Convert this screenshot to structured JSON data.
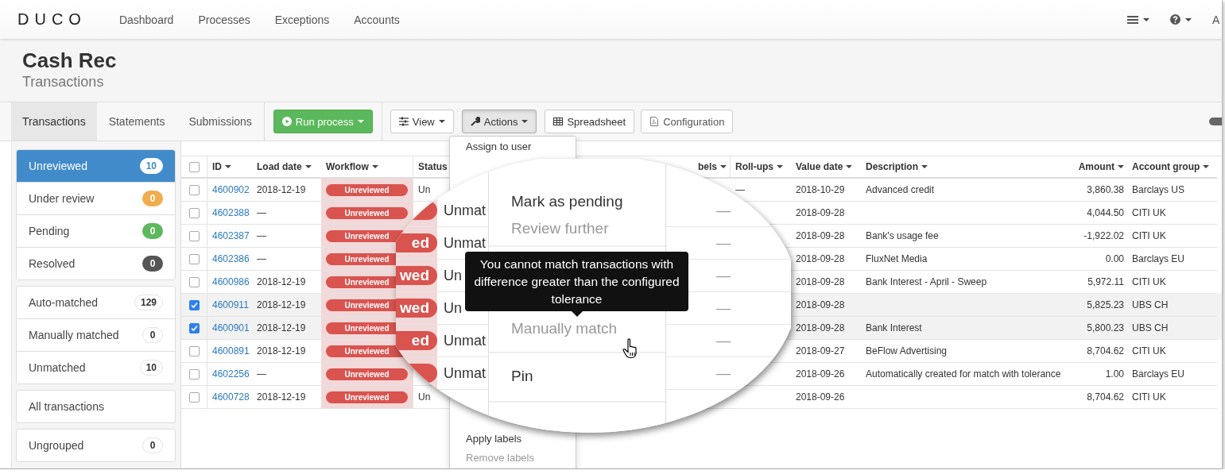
{
  "nav": {
    "logo": "DUCO",
    "links": [
      "Dashboard",
      "Processes",
      "Exceptions",
      "Accounts"
    ],
    "user_initial": "A"
  },
  "header": {
    "title": "Cash Rec",
    "subtitle": "Transactions"
  },
  "tabs": [
    {
      "label": "Transactions",
      "selected": true
    },
    {
      "label": "Statements",
      "selected": false
    },
    {
      "label": "Submissions",
      "selected": false
    }
  ],
  "toolbar": [
    {
      "label": "Run process",
      "kind": "run",
      "caret": true,
      "pressed": false
    },
    {
      "label": "View",
      "kind": "view",
      "caret": true,
      "pressed": false
    },
    {
      "label": "Actions",
      "kind": "actions",
      "caret": true,
      "pressed": true
    },
    {
      "label": "Spreadsheet",
      "kind": "spreadsheet",
      "caret": false,
      "pressed": false
    },
    {
      "label": "Configuration",
      "kind": "configuration",
      "caret": false,
      "pressed": false
    }
  ],
  "toolbar_toggle": {
    "on": true
  },
  "sidebar": {
    "groups": [
      {
        "items": [
          {
            "label": "Unreviewed",
            "count": "10",
            "color": "#ffffff",
            "selected": true
          },
          {
            "label": "Under review",
            "count": "0",
            "color": "#f0ad4e",
            "selected": false
          },
          {
            "label": "Pending",
            "count": "0",
            "color": "#5cb85c",
            "selected": false
          },
          {
            "label": "Resolved",
            "count": "0",
            "color": "#555555",
            "selected": false
          }
        ]
      },
      {
        "items": [
          {
            "label": "Auto-matched",
            "count": "129",
            "color": "#ffffff",
            "selected": false
          },
          {
            "label": "Manually matched",
            "count": "0",
            "color": "#ffffff",
            "selected": false
          },
          {
            "label": "Unmatched",
            "count": "10",
            "color": "#ffffff",
            "selected": false
          }
        ]
      },
      {
        "items": [
          {
            "label": "All transactions",
            "selected": false
          }
        ]
      },
      {
        "items": [
          {
            "label": "Ungrouped",
            "count": "0",
            "color": "#ffffff",
            "selected": false
          }
        ]
      }
    ]
  },
  "table": {
    "select_all_checked": false,
    "columns": [
      "ID",
      "Load date",
      "Workflow",
      "Status",
      "bels",
      "Roll-ups",
      "Value date",
      "Description",
      "Amount",
      "Account group"
    ],
    "rows": [
      {
        "checked": false,
        "id": "4600902",
        "load_date": "2018-12-19",
        "workflow": "Unreviewed",
        "status": "Un",
        "roll_ups": "—",
        "value_date": "2018-10-29",
        "description": "Advanced credit",
        "amount": "3,860.38",
        "account_group": "Barclays US"
      },
      {
        "checked": false,
        "id": "4602388",
        "load_date": "—",
        "workflow": "Unreviewed",
        "value_date": "2018-09-28",
        "amount": "4,044.50",
        "account_group": "CITI UK"
      },
      {
        "checked": false,
        "id": "4602387",
        "load_date": "—",
        "workflow": "Unreviewed",
        "value_date": "2018-09-28",
        "description": "Bank's usage fee",
        "amount": "-1,922.02",
        "account_group": "CITI UK"
      },
      {
        "checked": false,
        "id": "4602386",
        "load_date": "—",
        "workflow": "Unreviewed",
        "value_date": "2018-09-28",
        "description": "FluxNet Media",
        "amount": "0.00",
        "account_group": "Barclays EU"
      },
      {
        "checked": false,
        "id": "4600986",
        "load_date": "2018-12-19",
        "workflow": "Unreviewed",
        "value_date": "2018-09-28",
        "description": "Bank Interest - April - Sweep",
        "amount": "5,972.11",
        "account_group": "CITI UK"
      },
      {
        "checked": true,
        "id": "4600911",
        "load_date": "2018-12-19",
        "workflow": "Unreviewed",
        "value_date": "2018-09-28",
        "amount": "5,825.23",
        "account_group": "UBS CH"
      },
      {
        "checked": true,
        "id": "4600901",
        "load_date": "2018-12-19",
        "workflow": "Unreviewed",
        "value_date": "2018-09-28",
        "description": "Bank Interest",
        "amount": "5,800.23",
        "account_group": "UBS CH"
      },
      {
        "checked": false,
        "id": "4600891",
        "load_date": "2018-12-19",
        "workflow": "Unreviewed",
        "value_date": "2018-09-27",
        "description": "BeFlow Advertising",
        "amount": "8,704.62",
        "account_group": "CITI UK"
      },
      {
        "checked": false,
        "id": "4602256",
        "load_date": "—",
        "workflow": "Unreviewed",
        "value_date": "2018-09-26",
        "description": "Automatically created for match with tolerance",
        "amount": "1.00",
        "account_group": "Barclays EU"
      },
      {
        "checked": false,
        "id": "4600728",
        "load_date": "2018-12-19",
        "workflow": "Unreviewed",
        "status": "Un",
        "value_date": "2018-09-26",
        "amount": "8,704.62",
        "account_group": "CITI UK"
      }
    ]
  },
  "actions_menu": [
    {
      "label": "Assign to user",
      "disabled": false
    },
    {
      "label": "Apply labels",
      "disabled": false
    },
    {
      "label": "Remove labels",
      "disabled": true
    }
  ],
  "magnifier": {
    "rows": [
      {
        "status": "Unmat",
        "labels": "—"
      },
      {
        "pill": "ed",
        "status": "Unmat",
        "labels": "—"
      },
      {
        "pill": "wed",
        "status": "Un",
        "labels": "—"
      },
      {
        "pill": "wed",
        "status": "Un",
        "labels": "—"
      },
      {
        "pill": "ed",
        "status": "Unmat",
        "labels": "—"
      },
      {
        "status": "Unmat",
        "labels": "—"
      }
    ],
    "menu": [
      {
        "label": "Mark as pending",
        "disabled": false
      },
      {
        "label": "Review further",
        "disabled": true
      },
      {
        "label": "Manually match",
        "disabled": true
      },
      {
        "label": "Pin",
        "disabled": false
      }
    ],
    "tooltip": "You cannot match transactions with difference greater than the configured tolerance"
  }
}
